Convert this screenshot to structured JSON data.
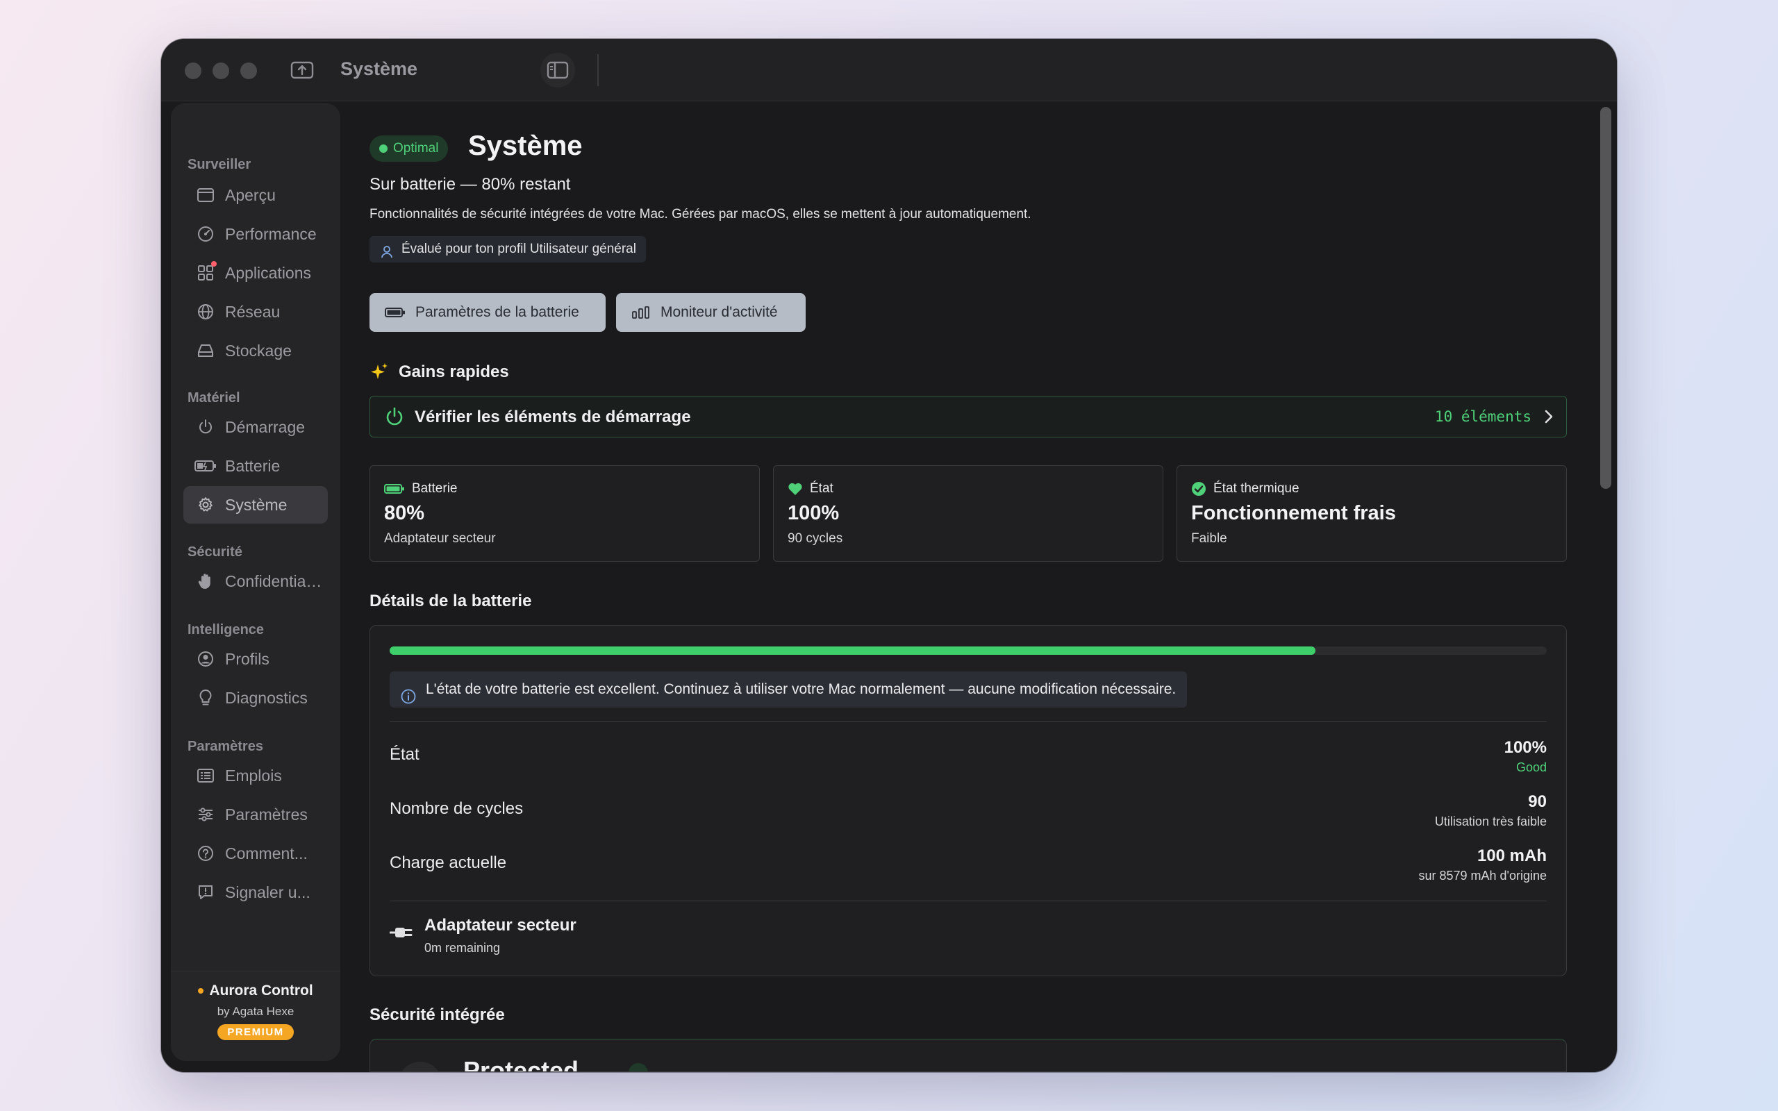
{
  "window": {
    "title": "Système"
  },
  "sidebar": {
    "sections": [
      {
        "heading": "Surveiller",
        "items": [
          {
            "label": "Aperçu",
            "icon": "window-icon"
          },
          {
            "label": "Performance",
            "icon": "gauge-icon"
          },
          {
            "label": "Applications",
            "icon": "apps-grid-icon"
          },
          {
            "label": "Réseau",
            "icon": "globe-icon"
          },
          {
            "label": "Stockage",
            "icon": "drive-icon"
          }
        ]
      },
      {
        "heading": "Matériel",
        "items": [
          {
            "label": "Démarrage",
            "icon": "power-icon"
          },
          {
            "label": "Batterie",
            "icon": "battery-icon"
          },
          {
            "label": "Système",
            "icon": "gear-icon",
            "active": true
          }
        ]
      },
      {
        "heading": "Sécurité",
        "items": [
          {
            "label": "Confidentialité",
            "icon": "hand-icon"
          }
        ]
      },
      {
        "heading": "Intelligence",
        "items": [
          {
            "label": "Profils",
            "icon": "person-icon"
          },
          {
            "label": "Diagnostics",
            "icon": "lightbulb-icon"
          }
        ]
      },
      {
        "heading": "Paramètres",
        "items": [
          {
            "label": "Emplois",
            "icon": "list-icon"
          },
          {
            "label": "Paramètres",
            "icon": "sliders-icon"
          },
          {
            "label": "Comment...",
            "icon": "question-icon"
          },
          {
            "label": "Signaler u...",
            "icon": "feedback-icon"
          }
        ]
      }
    ],
    "footer": {
      "brand": "Aurora Control",
      "byline": "by Agata Hexe",
      "badge": "PREMIUM"
    }
  },
  "header": {
    "status_badge": "Optimal",
    "title": "Système",
    "subtitle": "Sur batterie — 80% restant",
    "description": "Fonctionnalités de sécurité intégrées de votre Mac. Gérées par macOS, elles se mettent à jour automatiquement.",
    "profile_chip": "Évalué pour ton profil Utilisateur général"
  },
  "actions": {
    "battery_settings": "Paramètres de la batterie",
    "activity_monitor": "Moniteur d'activité"
  },
  "quick_wins": {
    "title": "Gains rapides",
    "item_label": "Vérifier les éléments de démarrage",
    "item_count": "10 éléments"
  },
  "stats": [
    {
      "label": "Batterie",
      "value": "80%",
      "sub": "Adaptateur secteur"
    },
    {
      "label": "État",
      "value": "100%",
      "sub": "90 cycles"
    },
    {
      "label": "État thermique",
      "value": "Fonctionnement frais",
      "sub": "Faible"
    }
  ],
  "battery_details": {
    "title": "Détails de la batterie",
    "level_percent": 80,
    "info": "L'état de votre batterie est excellent. Continuez à utiliser votre Mac normalement — aucune modification nécessaire.",
    "rows": [
      {
        "label": "État",
        "value": "100%",
        "sub": "Good"
      },
      {
        "label": "Nombre de cycles",
        "value": "90",
        "sub": "Utilisation très faible"
      },
      {
        "label": "Charge actuelle",
        "value": "100 mAh",
        "sub": "sur 8579 mAh d'origine"
      }
    ],
    "adapter": {
      "title": "Adaptateur secteur",
      "sub": "0m remaining"
    }
  },
  "security": {
    "title": "Sécurité intégrée",
    "card_title": "Protected"
  },
  "colors": {
    "accent_green": "#4fd17a",
    "premium": "#f5a623"
  }
}
